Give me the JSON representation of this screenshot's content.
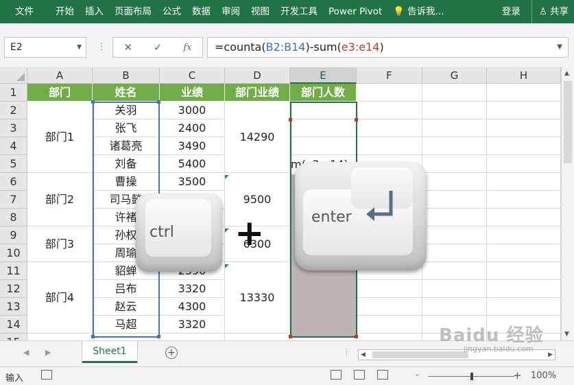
{
  "ribbon": {
    "tabs": [
      "文件",
      "开始",
      "插入",
      "页面布局",
      "公式",
      "数据",
      "审阅",
      "视图",
      "开发工具",
      "Power Pivot"
    ],
    "tell_me": "告诉我...",
    "login": "登录",
    "share": "共享",
    "colors": {
      "ribbon_bg": "#217346",
      "header_fill": "#70ad47"
    }
  },
  "formula_bar": {
    "name_box": "E2",
    "cancel_icon": "✕",
    "enter_icon": "✓",
    "fx_label": "fx",
    "formula_part1": "=counta(",
    "formula_ref1": "B2:B14",
    "formula_part2": ")-sum(",
    "formula_ref2": "e3:e14",
    "formula_part3": ")"
  },
  "grid": {
    "columns": [
      "A",
      "B",
      "C",
      "D",
      "E",
      "F",
      "G",
      "H"
    ],
    "selected_column": "E",
    "rows": [
      "1",
      "2",
      "3",
      "4",
      "5",
      "6",
      "7",
      "8",
      "9",
      "10",
      "11",
      "12",
      "13",
      "14",
      "15"
    ],
    "headers": [
      "部门",
      "姓名",
      "业绩",
      "部门业绩",
      "部门人数"
    ],
    "depts": [
      {
        "name": "部门1",
        "total": "14290"
      },
      {
        "name": "部门2",
        "total": "9500"
      },
      {
        "name": "部门3",
        "total": "6300"
      },
      {
        "name": "部门4",
        "total": "13330"
      }
    ],
    "names": [
      "关羽",
      "张飞",
      "诸葛亮",
      "刘备",
      "曹操",
      "司马懿",
      "许褚",
      "孙权",
      "周瑜",
      "貂蝉",
      "吕布",
      "赵云",
      "马超"
    ],
    "scores": [
      "3000",
      "2400",
      "3490",
      "5400",
      "3500",
      "",
      "",
      "",
      "",
      "2390",
      "3320",
      "4300",
      "3320"
    ],
    "editing_text": "m(e3:e14)"
  },
  "keys": {
    "ctrl": "ctrl",
    "plus": "+",
    "enter": "enter"
  },
  "sheets": {
    "active": "Sheet1",
    "add": "+"
  },
  "status": {
    "mode": "输入",
    "zoom_minus": "-",
    "zoom_plus": "+",
    "zoom": "100%"
  },
  "watermark": {
    "main": "Baidu 经验",
    "sub": "jingyan.baidu.com"
  }
}
